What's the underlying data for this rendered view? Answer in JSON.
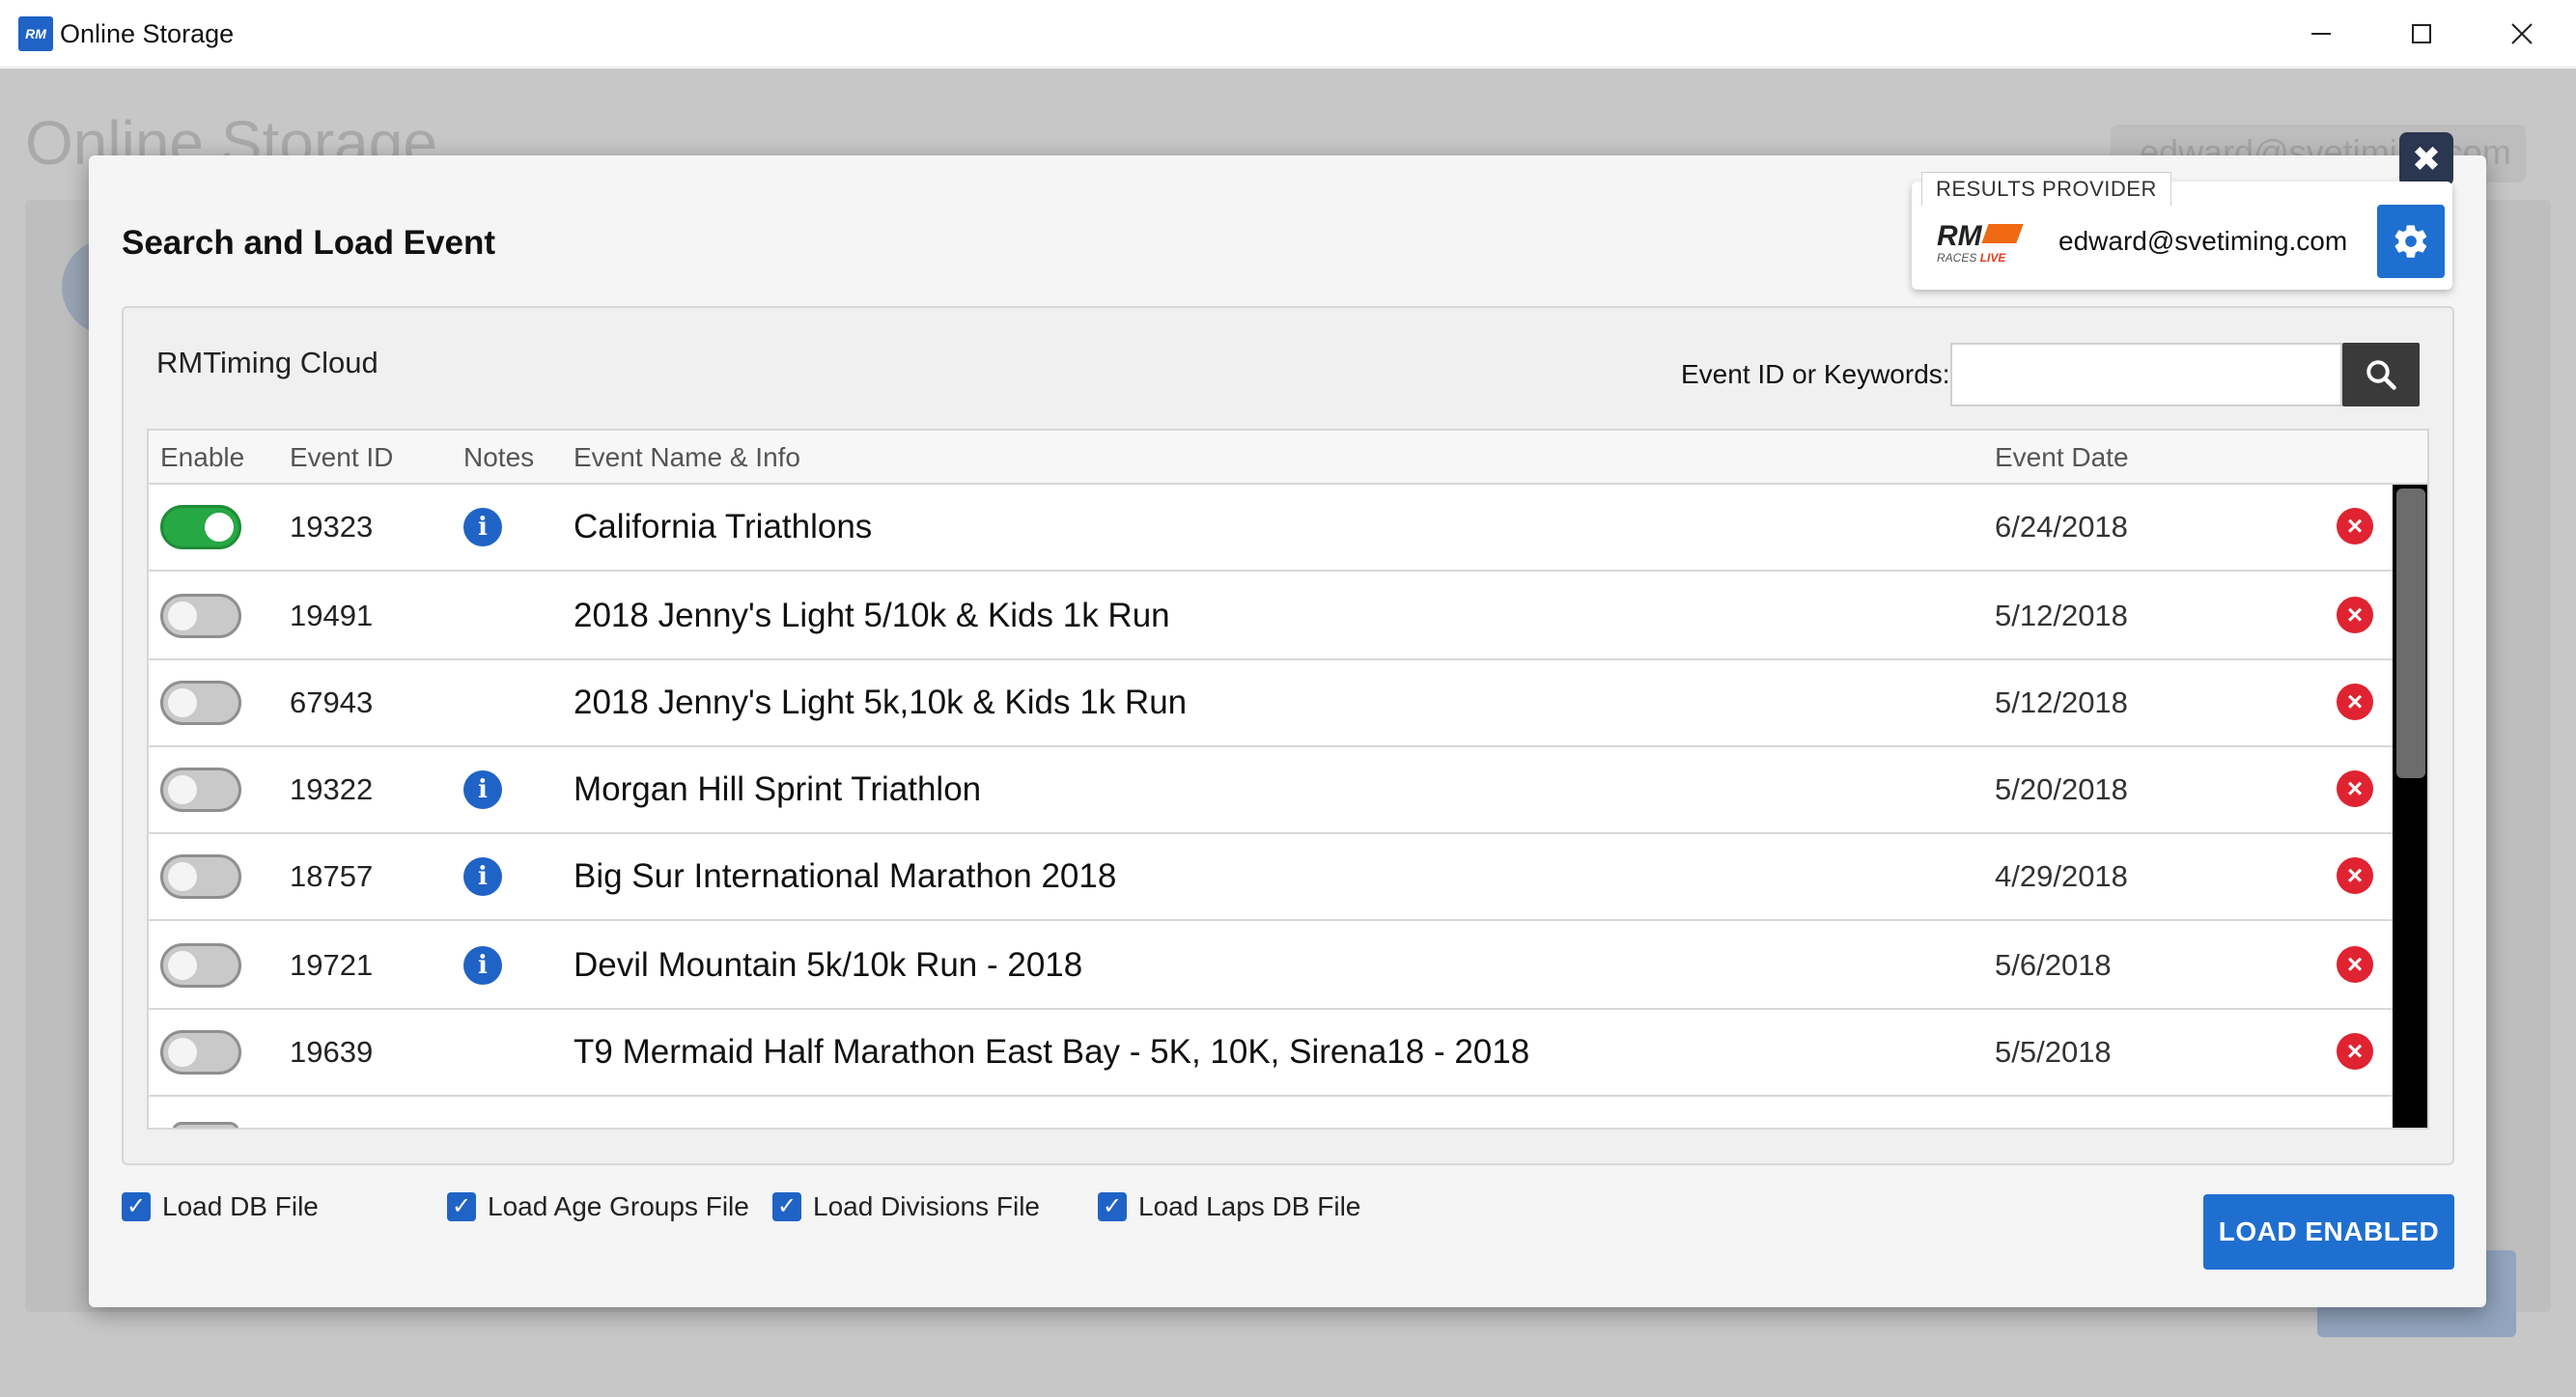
{
  "window": {
    "app_icon_text": "RM",
    "title": "Online Storage",
    "minimize_icon": "minimize-icon",
    "maximize_icon": "maximize-icon",
    "close_label": "✕"
  },
  "background": {
    "heading": "Online Storage",
    "email": "edward@svetiming.com"
  },
  "modal": {
    "title": "Search and Load Event",
    "close_label": "✖",
    "provider": {
      "label": "RESULTS PROVIDER",
      "logo_text": "RM",
      "logo_sub_a": "RACES",
      "logo_sub_b": "LIVE",
      "email": "edward@svetiming.com",
      "settings_icon": "gear-icon"
    },
    "panel": {
      "title": "RMTiming Cloud",
      "search_label": "Event ID or Keywords:",
      "search_value": "",
      "search_icon": "search-icon"
    },
    "table": {
      "headers": {
        "enable": "Enable",
        "event_id": "Event ID",
        "notes": "Notes",
        "name": "Event Name & Info",
        "date": "Event Date"
      },
      "rows": [
        {
          "enabled": true,
          "id": "19323",
          "has_notes": true,
          "name": "California Triathlons",
          "date": "6/24/2018"
        },
        {
          "enabled": false,
          "id": "19491",
          "has_notes": false,
          "name": "2018 Jenny's Light 5/10k & Kids 1k Run",
          "date": "5/12/2018"
        },
        {
          "enabled": false,
          "id": "67943",
          "has_notes": false,
          "name": "2018 Jenny's Light 5k,10k & Kids 1k Run",
          "date": "5/12/2018"
        },
        {
          "enabled": false,
          "id": "19322",
          "has_notes": true,
          "name": "Morgan Hill Sprint Triathlon",
          "date": "5/20/2018"
        },
        {
          "enabled": false,
          "id": "18757",
          "has_notes": true,
          "name": "Big Sur International Marathon 2018",
          "date": "4/29/2018"
        },
        {
          "enabled": false,
          "id": "19721",
          "has_notes": true,
          "name": "Devil Mountain 5k/10k Run - 2018",
          "date": "5/6/2018"
        },
        {
          "enabled": false,
          "id": "19639",
          "has_notes": false,
          "name": "T9 Mermaid Half Marathon East Bay - 5K, 10K, Sirena18 - 2018",
          "date": "5/5/2018"
        }
      ]
    },
    "options": {
      "load_db": "Load DB File",
      "load_age_groups": "Load Age Groups File",
      "load_divisions": "Load Divisions File",
      "load_laps_db": "Load Laps DB File"
    },
    "load_button": "LOAD ENABLED"
  },
  "colors": {
    "accent": "#1f6fd1",
    "toggle_on": "#26a844",
    "remove": "#e02331"
  }
}
